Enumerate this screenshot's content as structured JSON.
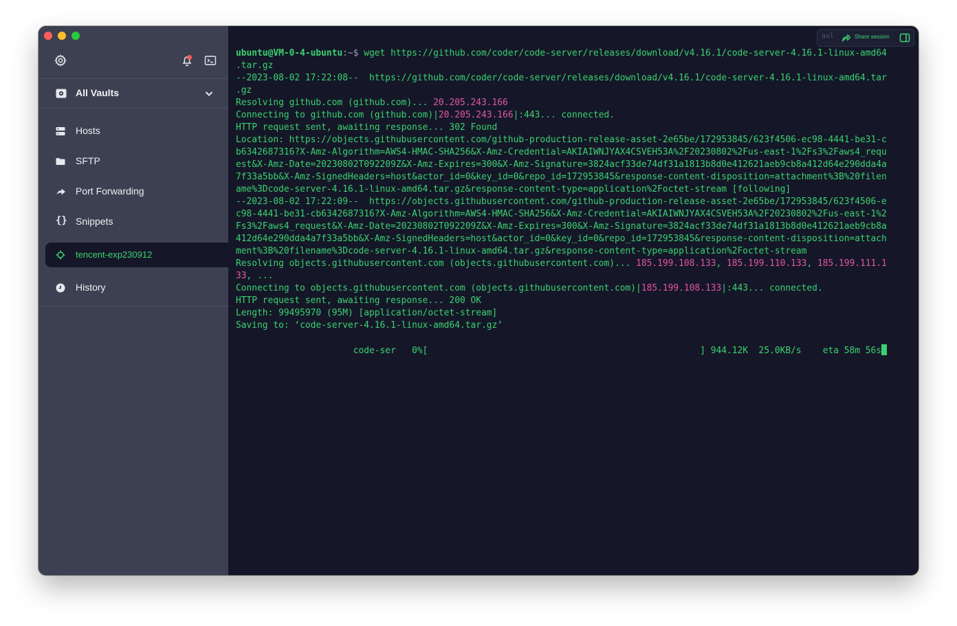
{
  "sidebar": {
    "vault_selector": {
      "label": "All Vaults"
    },
    "items": [
      {
        "label": "Hosts",
        "icon": "hosts-icon"
      },
      {
        "label": "SFTP",
        "icon": "folder-icon"
      },
      {
        "label": "Port Forwarding",
        "icon": "port-forwarding-icon"
      },
      {
        "label": "Snippets",
        "icon": "braces-icon",
        "glyph": "{}"
      }
    ],
    "active_host": {
      "label": "tencent-exp230912",
      "icon": "host-connection-icon"
    },
    "history": {
      "label": "History",
      "icon": "clock-icon"
    }
  },
  "toolbar": {
    "session_tab": "aul",
    "share_label": "Share session"
  },
  "terminal": {
    "prompt_user": "ubuntu@VM-0-4-ubuntu",
    "prompt_sep": ":~$",
    "command": " wget https://github.com/coder/code-server/releases/download/v4.16.1/code-server-4.16.1-linux-amd64",
    "lines": {
      "l1": ".tar.gz",
      "l2": "--2023-08-02 17:22:08--  https://github.com/coder/code-server/releases/download/v4.16.1/code-server-4.16.1-linux-amd64.tar",
      "l3": ".gz",
      "l4a": "Resolving github.com (github.com)... ",
      "l4ip": "20.205.243.166",
      "l5a": "Connecting to github.com (github.com)|",
      "l5ip": "20.205.243.166",
      "l5b": "|:443... connected.",
      "l6": "HTTP request sent, awaiting response... 302 Found",
      "l7": "Location: https://objects.githubusercontent.com/github-production-release-asset-2e65be/172953845/623f4506-ec98-4441-be31-c",
      "l8": "b6342687316?X-Amz-Algorithm=AWS4-HMAC-SHA256&X-Amz-Credential=AKIAIWNJYAX4CSVEH53A%2F20230802%2Fus-east-1%2Fs3%2Faws4_requ",
      "l9": "est&X-Amz-Date=20230802T092209Z&X-Amz-Expires=300&X-Amz-Signature=3824acf33de74df31a1813b8d0e412621aeb9cb8a412d64e290dda4a",
      "l10": "7f33a5bb&X-Amz-SignedHeaders=host&actor_id=0&key_id=0&repo_id=172953845&response-content-disposition=attachment%3B%20filen",
      "l11": "ame%3Dcode-server-4.16.1-linux-amd64.tar.gz&response-content-type=application%2Foctet-stream [following]",
      "l12": "--2023-08-02 17:22:09--  https://objects.githubusercontent.com/github-production-release-asset-2e65be/172953845/623f4506-e",
      "l13": "c98-4441-be31-cb6342687316?X-Amz-Algorithm=AWS4-HMAC-SHA256&X-Amz-Credential=AKIAIWNJYAX4CSVEH53A%2F20230802%2Fus-east-1%2",
      "l14": "Fs3%2Faws4_request&X-Amz-Date=20230802T092209Z&X-Amz-Expires=300&X-Amz-Signature=3824acf33de74df31a1813b8d0e412621aeb9cb8a",
      "l15": "412d64e290dda4a7f33a5bb&X-Amz-SignedHeaders=host&actor_id=0&key_id=0&repo_id=172953845&response-content-disposition=attach",
      "l16": "ment%3B%20filename%3Dcode-server-4.16.1-linux-amd64.tar.gz&response-content-type=application%2Foctet-stream",
      "l17a": "Resolving objects.githubusercontent.com (objects.githubusercontent.com)... ",
      "l17ip1": "185.199.108.133",
      "l17c1": ", ",
      "l17ip2": "185.199.110.133",
      "l17c2": ", ",
      "l17ip3": "185.199.111.1",
      "l18ip": "33",
      "l18b": ", ...",
      "l19a": "Connecting to objects.githubusercontent.com (objects.githubusercontent.com)|",
      "l19ip": "185.199.108.133",
      "l19b": "|:443... connected.",
      "l20": "HTTP request sent, awaiting response... 200 OK",
      "l21": "Length: 99495970 (95M) [application/octet-stream]",
      "l22": "Saving to: ‘code-server-4.16.1-linux-amd64.tar.gz’",
      "progress": "                      code-ser   0%[                                                   ] 944.12K  25.0KB/s    eta 58m 56s"
    }
  },
  "colors": {
    "sidebar_bg": "#3c4050",
    "terminal_bg": "#151728",
    "accent_green": "#3bd271",
    "ip_pink": "#e455a6"
  }
}
